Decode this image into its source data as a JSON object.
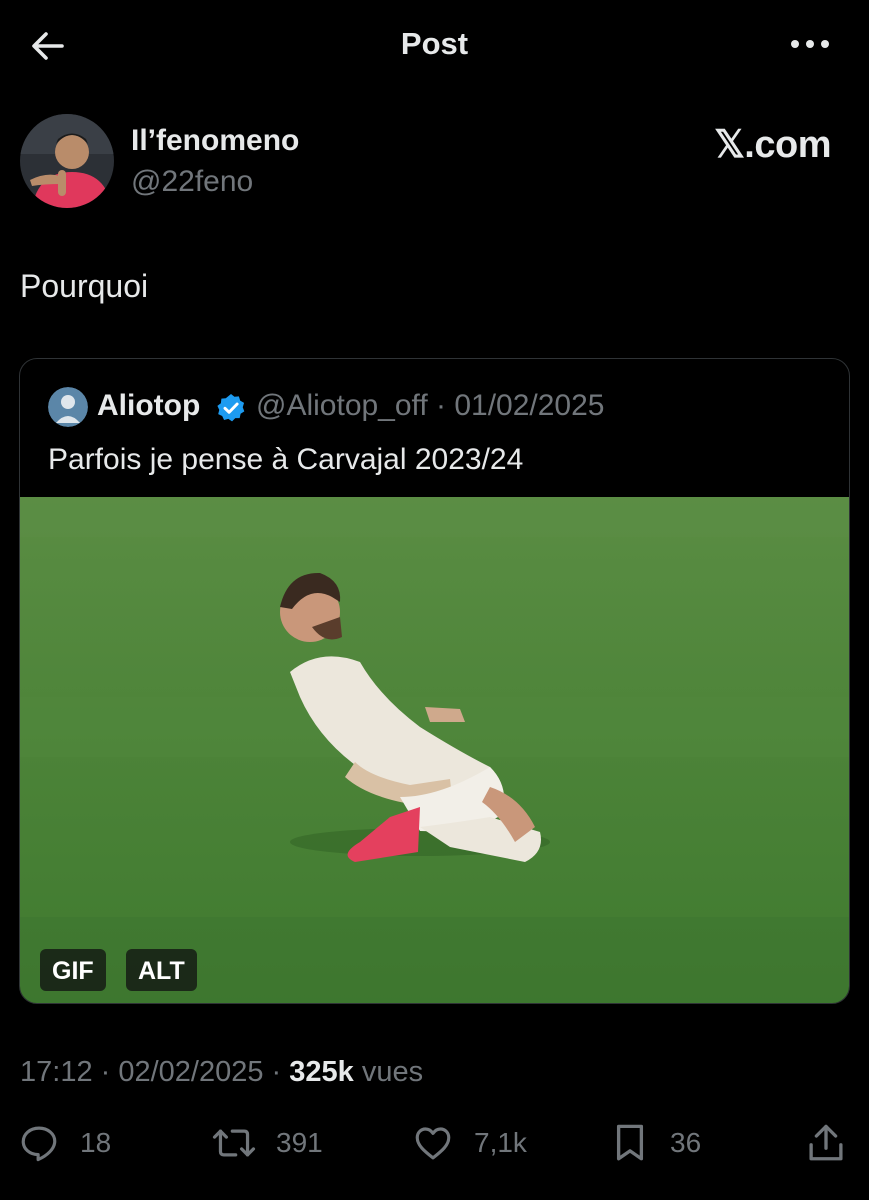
{
  "header": {
    "title": "Post",
    "back_icon": "arrow-left-icon",
    "more_icon": "more-horizontal-icon"
  },
  "author": {
    "name": "Il’fenomeno",
    "handle": "@22feno",
    "avatar_icon": "user-avatar"
  },
  "watermark": "𝕏.com",
  "post": {
    "text": "Pourquoi"
  },
  "quote": {
    "name": "Aliotop",
    "verified": true,
    "handle_date": "@Aliotop_off · 01/02/2025",
    "text": "Parfois je pense à Carvajal 2023/24",
    "media": {
      "kind": "GIF",
      "gif_label": "GIF",
      "alt_label": "ALT"
    }
  },
  "meta": {
    "time_date": "17:12 · 02/02/2025 · ",
    "views": "325k",
    "views_suffix": " vues"
  },
  "actions": [
    {
      "icon": "reply-icon",
      "count": "18"
    },
    {
      "icon": "repost-icon",
      "count": "391"
    },
    {
      "icon": "like-icon",
      "count": "7,1k"
    },
    {
      "icon": "bookmark-icon",
      "count": "36"
    },
    {
      "icon": "share-icon",
      "count": ""
    }
  ],
  "colors": {
    "background": "#000000",
    "text": "#e7e9ea",
    "muted": "#71767b",
    "border": "#2f3336",
    "verified": "#1d9bf0",
    "pitch": "#4f8a3a"
  }
}
